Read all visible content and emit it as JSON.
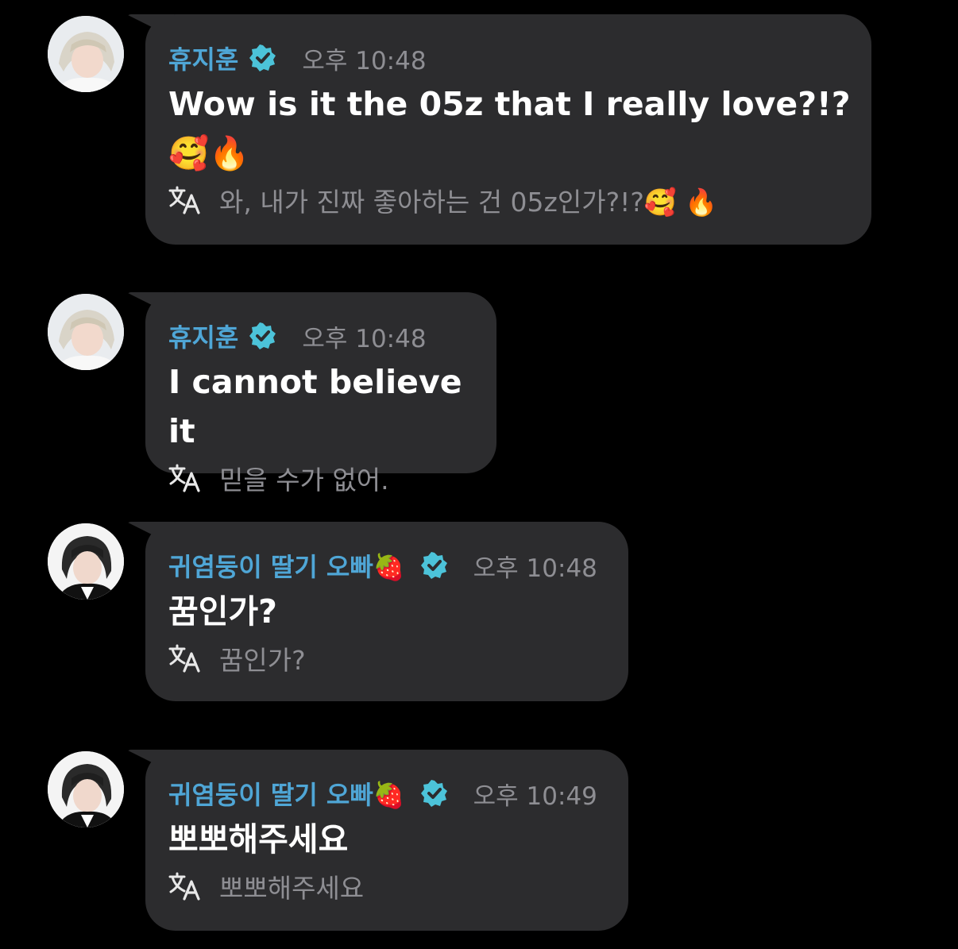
{
  "messages": [
    {
      "author": "휴지훈",
      "time": "오후 10:48",
      "text": "Wow is it the 05z that I really love?!?🥰🔥",
      "translation": "와, 내가 진짜 좋아하는 건 05z인가?!?🥰 🔥",
      "avatar": "avatar-blond"
    },
    {
      "author": "휴지훈",
      "time": "오후 10:48",
      "text": "I cannot believe it",
      "translation": "믿을 수가 없어.",
      "avatar": "avatar-blond"
    },
    {
      "author": "귀염둥이 딸기 오빠🍓",
      "time": "오후 10:48",
      "text": "꿈인가?",
      "translation": "꿈인가?",
      "avatar": "avatar-dark"
    },
    {
      "author": "귀염둥이 딸기 오빠🍓",
      "time": "오후 10:49",
      "text": "뽀뽀해주세요",
      "translation": "뽀뽀해주세요",
      "avatar": "avatar-dark"
    }
  ],
  "icons": {
    "verified": "verified-badge-icon",
    "translate": "translate-icon"
  },
  "colors": {
    "background": "#000000",
    "bubble": "#2c2c2e",
    "name": "#4fa6d6",
    "badge": "#4cc3d9",
    "time": "#8e8e93",
    "text": "#ffffff",
    "translation": "#8e8e93"
  }
}
